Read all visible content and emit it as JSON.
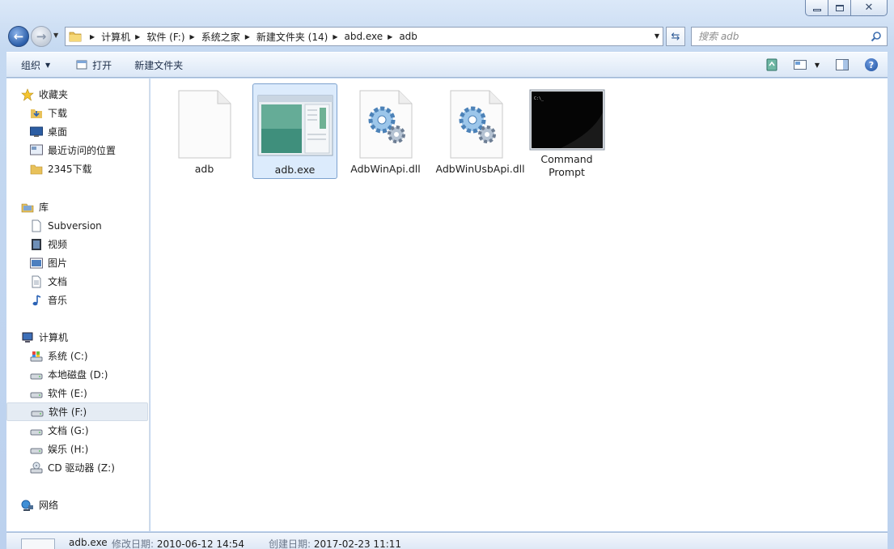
{
  "window": {
    "caption": {
      "minimize": "▭",
      "maximize": "□",
      "close": "✕"
    }
  },
  "address_bar": {
    "crumbs": [
      "计算机",
      "软件 (F:)",
      "系统之家",
      "新建文件夹 (14)",
      "abd.exe",
      "adb"
    ]
  },
  "search": {
    "placeholder": "搜索 adb"
  },
  "toolbar": {
    "organize": "组织",
    "open": "打开",
    "new_folder": "新建文件夹"
  },
  "nav": {
    "favorites": {
      "title": "收藏夹",
      "items": [
        "下载",
        "桌面",
        "最近访问的位置",
        "2345下载"
      ]
    },
    "libraries": {
      "title": "库",
      "items": [
        "Subversion",
        "视频",
        "图片",
        "文档",
        "音乐"
      ]
    },
    "computer": {
      "title": "计算机",
      "items": [
        "系统 (C:)",
        "本地磁盘 (D:)",
        "软件 (E:)",
        "软件 (F:)",
        "文档 (G:)",
        "娱乐 (H:)",
        "CD 驱动器 (Z:)"
      ],
      "selected": "软件 (F:)"
    },
    "network": {
      "title": "网络"
    }
  },
  "files": [
    {
      "name": "adb",
      "type": "blank"
    },
    {
      "name": "adb.exe",
      "type": "exe",
      "selected": true
    },
    {
      "name": "AdbWinApi.dll",
      "type": "dll"
    },
    {
      "name": "AdbWinUsbApi.dll",
      "type": "dll"
    },
    {
      "name": "Command Prompt",
      "type": "cmd"
    }
  ],
  "details": {
    "name": "adb.exe",
    "modified_label": "修改日期:",
    "modified": "2010-06-12 14:54",
    "created_label": "创建日期:",
    "created": "2017-02-23 11:11"
  },
  "colors": {
    "selection_bg": "#dcebfc",
    "selection_border": "#7da2ce",
    "chrome": "#c5d9f1"
  }
}
